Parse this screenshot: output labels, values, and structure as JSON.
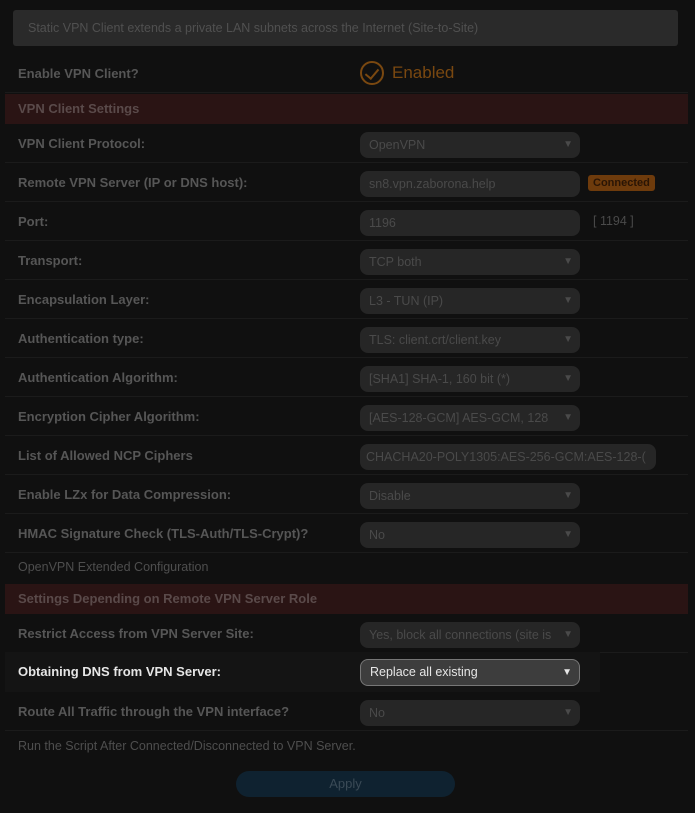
{
  "banner": "Static VPN Client extends a private LAN subnets across the Internet (Site-to-Site)",
  "enable": {
    "label": "Enable VPN Client?",
    "value": "Enabled"
  },
  "sections": {
    "client_settings": "VPN Client Settings",
    "server_role": "Settings Depending on Remote VPN Server Role"
  },
  "protocol": {
    "label": "VPN Client Protocol:",
    "value": "OpenVPN"
  },
  "server": {
    "label": "Remote VPN Server (IP or DNS host):",
    "value": "sn8.vpn.zaborona.help",
    "status": "Connected"
  },
  "port": {
    "label": "Port:",
    "value": "1196",
    "hint": "[ 1194 ]"
  },
  "transport": {
    "label": "Transport:",
    "value": "TCP both"
  },
  "encapsulation": {
    "label": "Encapsulation Layer:",
    "value": "L3 - TUN (IP)"
  },
  "auth_type": {
    "label": "Authentication type:",
    "value": "TLS: client.crt/client.key"
  },
  "auth_algo": {
    "label": "Authentication Algorithm:",
    "value": "[SHA1] SHA-1, 160 bit (*)"
  },
  "cipher": {
    "label": "Encryption Cipher Algorithm:",
    "value": "[AES-128-GCM] AES-GCM, 128"
  },
  "ncp": {
    "label": "List of Allowed NCP Ciphers",
    "value": "CHACHA20-POLY1305:AES-256-GCM:AES-128-("
  },
  "lzx": {
    "label": "Enable LZx for Data Compression:",
    "value": "Disable"
  },
  "hmac": {
    "label": "HMAC Signature Check (TLS-Auth/TLS-Crypt)?",
    "value": "No"
  },
  "extended": "OpenVPN Extended Configuration",
  "restrict": {
    "label": "Restrict Access from VPN Server Site:",
    "value": "Yes, block all connections (site is"
  },
  "dns": {
    "label": "Obtaining DNS from VPN Server:",
    "value": "Replace all existing"
  },
  "route": {
    "label": "Route All Traffic through the VPN interface?",
    "value": "No"
  },
  "script_note": "Run the Script After Connected/Disconnected to VPN Server.",
  "apply_label": "Apply",
  "colors": {
    "accent": "#e8801a",
    "highlight_text": "#e6e6e6",
    "section_bg": "#2a1414"
  }
}
